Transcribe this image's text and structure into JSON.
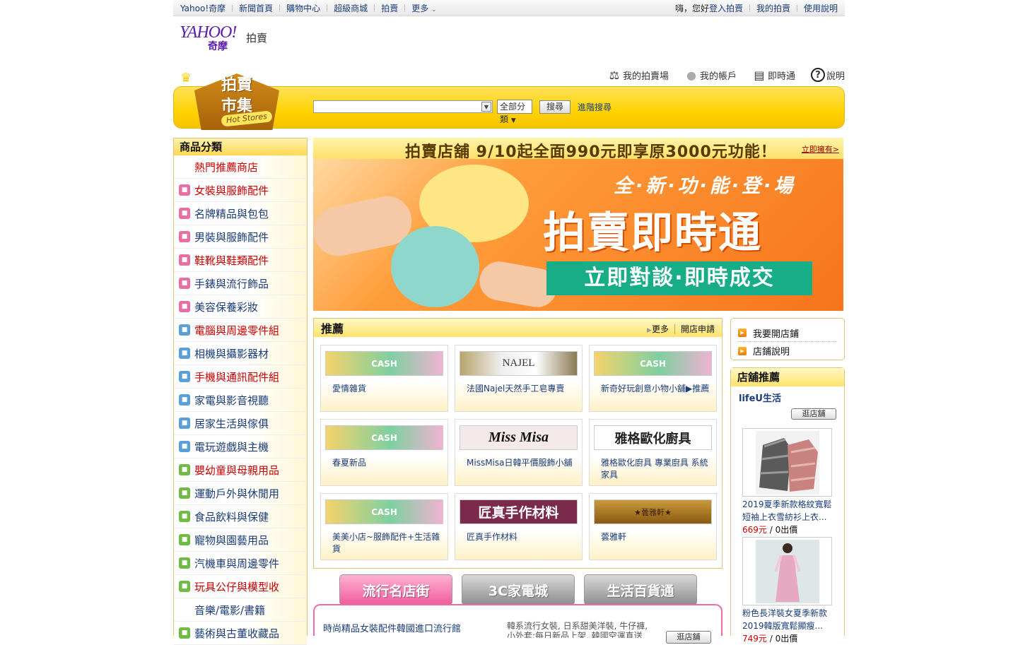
{
  "topbar": {
    "left": [
      "Yahoo!奇摩",
      "新聞首頁",
      "購物中心",
      "超級商城",
      "拍賣",
      "更多"
    ],
    "user_label": "嗨，您好",
    "right": [
      "登入拍賣",
      "我的拍賣",
      "使用說明"
    ]
  },
  "logo": {
    "brand": "YAHOO!",
    "sub": "奇摩",
    "section": "拍賣"
  },
  "quick": [
    "我的拍賣場",
    "我的帳戶",
    "即時通",
    "說明"
  ],
  "badge": {
    "line1": "拍賣",
    "line2": "市集",
    "tag": "Hot Stores"
  },
  "search": {
    "input_value": "",
    "scope": "全部分類",
    "button": "搜尋",
    "advanced": "進階搜尋"
  },
  "sidebar": {
    "title": "商品分類",
    "items": [
      {
        "label": "熱門推薦商店",
        "red": true,
        "icon": "none"
      },
      {
        "label": "女裝與服飾配件",
        "red": true,
        "icon": "shirt-icon",
        "color": "#e86ea7"
      },
      {
        "label": "名牌精品與包包",
        "red": false,
        "icon": "bag-icon",
        "color": "#e86ea7"
      },
      {
        "label": "男裝與服飾配件",
        "red": false,
        "icon": "tie-icon",
        "color": "#e86ea7"
      },
      {
        "label": "鞋靴與鞋類配件",
        "red": true,
        "icon": "shoe-icon",
        "color": "#e86ea7"
      },
      {
        "label": "手錶與流行飾品",
        "red": false,
        "icon": "watch-icon",
        "color": "#e86ea7"
      },
      {
        "label": "美容保養彩妝",
        "red": false,
        "icon": "face-icon",
        "color": "#e86ea7"
      },
      {
        "label": "電腦與周邊零件組",
        "red": true,
        "icon": "monitor-icon",
        "color": "#5a9fd8"
      },
      {
        "label": "相機與攝影器材",
        "red": false,
        "icon": "camera-icon",
        "color": "#5a9fd8"
      },
      {
        "label": "手機與通訊配件組",
        "red": true,
        "icon": "phone-icon",
        "color": "#5a9fd8"
      },
      {
        "label": "家電與影音視聽",
        "red": false,
        "icon": "tv-icon",
        "color": "#5a9fd8"
      },
      {
        "label": "居家生活與傢俱",
        "red": false,
        "icon": "home-icon",
        "color": "#5a9fd8"
      },
      {
        "label": "電玩遊戲與主機",
        "red": false,
        "icon": "game-icon",
        "color": "#5a9fd8"
      },
      {
        "label": "嬰幼童與母親用品",
        "red": true,
        "icon": "baby-icon",
        "color": "#71bb45"
      },
      {
        "label": "運動戶外與休閒用",
        "red": false,
        "icon": "ball-icon",
        "color": "#71bb45"
      },
      {
        "label": "食品飲料與保健",
        "red": false,
        "icon": "food-icon",
        "color": "#71bb45"
      },
      {
        "label": "寵物與園藝用品",
        "red": false,
        "icon": "pet-icon",
        "color": "#71bb45"
      },
      {
        "label": "汽機車與周邊零件",
        "red": false,
        "icon": "car-icon",
        "color": "#71bb45"
      },
      {
        "label": "玩具公仔與模型收",
        "red": true,
        "icon": "toy-icon",
        "color": "#71bb45"
      },
      {
        "label": "音樂/電影/書籍",
        "red": false,
        "icon": "none"
      },
      {
        "label": "藝術與古董收藏品",
        "red": false,
        "icon": "art-icon",
        "color": "#71bb45"
      }
    ]
  },
  "banner": {
    "strip_text": "拍賣店舖 9/10起全面990元即享原3000元功能！",
    "strip_link": "立即擁有>",
    "hero_line1": "全·新·功·能·登·場",
    "hero_line2": "拍賣即時通",
    "hero_line3": "立即對談·即時成交"
  },
  "stores": {
    "title": "推薦",
    "more": "更多",
    "open": "開店申請",
    "cards": [
      {
        "img": "CASH",
        "name": "愛情雜貨"
      },
      {
        "img": "NAJEL",
        "name": "法國Najel天然手工皂專賣"
      },
      {
        "img": "CASH",
        "name": "新奇好玩創意小物小舖▶推薦"
      },
      {
        "img": "CASH",
        "name": "春夏新品"
      },
      {
        "img": "Miss Misa",
        "name": "MissMisa日韓平價服飾小舖"
      },
      {
        "img": "雅格歐化廚具",
        "name": "雅格歐化廚具 專業廚具 系統家具"
      },
      {
        "img": "CASH",
        "name": "美美小店~服飾配件+生活雜貨"
      },
      {
        "img": "匠真手作材料",
        "name": "匠真手作材料"
      },
      {
        "img": "★蕓雅軒★",
        "name": "蕓雅軒"
      }
    ]
  },
  "tabs": [
    "流行名店街",
    "3C家電城",
    "生活百貨通"
  ],
  "listing": {
    "title": "時尚精品女裝配件韓國進口流行館",
    "desc": "韓系流行女裝, 日系甜美洋裝, 牛仔褲, 小外套;每日新品上架, 韓國空運直送款式, 平價時尚穿搭, 流行配件",
    "button": "逛店舖"
  },
  "right": {
    "links": [
      "我要開店鋪",
      "店鋪說明"
    ],
    "featured_title": "店舖推薦",
    "shop_name": "lifeU生活",
    "enter_label": "逛店舖",
    "items": [
      {
        "title": "2019夏季新款格紋寬鬆短袖上衣雪紡衫上衣...",
        "price": "669元",
        "bids": " / 0出價"
      },
      {
        "title": "粉色長洋裝女夏季新款2019韓版寬鬆顯瘦...",
        "price": "749元",
        "bids": " / 0出價"
      }
    ]
  }
}
